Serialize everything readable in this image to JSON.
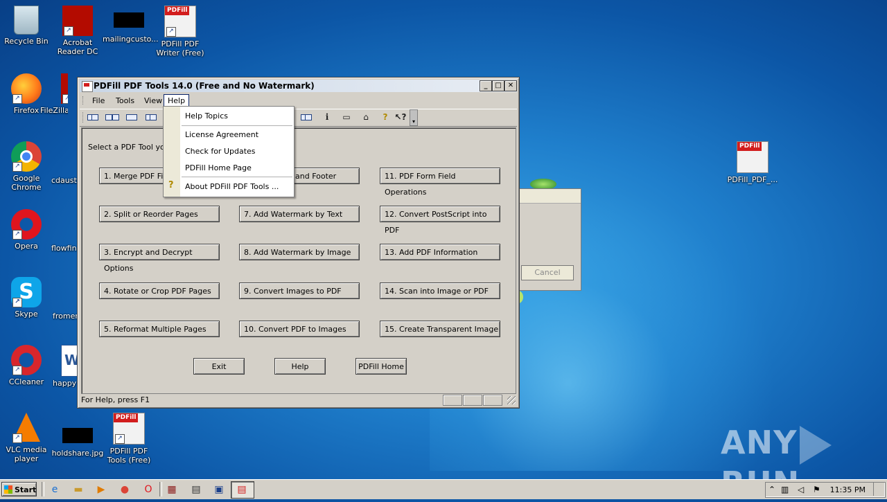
{
  "desktop": {
    "icons": [
      {
        "label": "Recycle Bin",
        "icon": "recycle-bin-icon"
      },
      {
        "label": "Acrobat Reader DC",
        "icon": "acrobat-icon"
      },
      {
        "label": "mailingcusto...",
        "icon": "file-icon"
      },
      {
        "label": "PDFill PDF Writer (Free)",
        "icon": "pdffill-writer-icon"
      },
      {
        "label": "Firefox",
        "icon": "firefox-icon"
      },
      {
        "label": "FileZilla",
        "icon": "filezilla-icon"
      },
      {
        "label": "Google Chrome",
        "icon": "chrome-icon"
      },
      {
        "label": "cdaust",
        "icon": "file-icon"
      },
      {
        "label": "Opera",
        "icon": "opera-icon"
      },
      {
        "label": "flowfin",
        "icon": "file-icon"
      },
      {
        "label": "Skype",
        "icon": "skype-icon"
      },
      {
        "label": "fromen",
        "icon": "file-icon"
      },
      {
        "label": "CCleaner",
        "icon": "ccleaner-icon"
      },
      {
        "label": "happy",
        "icon": "word-icon"
      },
      {
        "label": "VLC media player",
        "icon": "vlc-icon"
      },
      {
        "label": "holdshare.jpg",
        "icon": "image-icon"
      },
      {
        "label": "PDFill PDF Tools (Free)",
        "icon": "pdffill-tools-icon"
      },
      {
        "label": "PDFill_PDF_...",
        "icon": "installer-icon"
      }
    ]
  },
  "window": {
    "title": "PDFill PDF Tools 14.0 (Free and No Watermark)",
    "menu": [
      "File",
      "Tools",
      "View",
      "Help"
    ],
    "prompt": "Select a PDF Tool you c",
    "tools": [
      "1. Merge PDF Files",
      "2. Split or Reorder Pages",
      "3. Encrypt and Decrypt Options",
      "4. Rotate or Crop PDF Pages",
      "5. Reformat Multiple Pages",
      "and Footer",
      "7. Add Watermark by Text",
      "8. Add Watermark by Image",
      "9. Convert Images to PDF",
      "10. Convert PDF to Images",
      "11. PDF Form Field Operations",
      "12. Convert PostScript into PDF",
      "13. Add PDF Information",
      "14. Scan into Image or PDF",
      "15. Create Transparent Image"
    ],
    "footer_buttons": [
      "Exit",
      "Help",
      "PDFill Home"
    ],
    "status": "For Help, press F1"
  },
  "help_menu": {
    "items": [
      "Help Topics",
      "License Agreement",
      "Check for Updates",
      "PDFill Home Page",
      "About PDFill PDF Tools ..."
    ]
  },
  "background_dialog": {
    "cancel_label": "Cancel"
  },
  "watermark": {
    "left": "ANY",
    "right": "RUN"
  },
  "taskbar": {
    "start_label": "Start",
    "clock": "11:35 PM"
  }
}
